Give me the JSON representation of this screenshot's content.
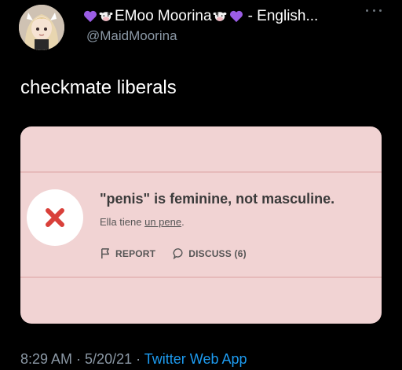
{
  "header": {
    "display_name": "EMoo Moorina",
    "name_suffix": "- English...",
    "handle": "@MaidMoorina",
    "leading_icons": [
      "purple-heart-icon",
      "cow-face-icon"
    ],
    "trailing_icons": [
      "cow-face-icon",
      "purple-heart-icon"
    ],
    "more_icon": "more-options-icon"
  },
  "tweet": {
    "text": "checkmate liberals"
  },
  "card": {
    "result_icon": "wrong-x-icon",
    "title": "\"penis\" is feminine, not masculine.",
    "sentence_before": "Ella tiene ",
    "sentence_highlight": "un pene",
    "sentence_after": ".",
    "report_label": "REPORT",
    "discuss_label": "DISCUSS (6)",
    "colors": {
      "card_bg": "#f1d3d3",
      "x_red": "#d9403a"
    }
  },
  "footer": {
    "time": "8:29 AM",
    "dot1": " · ",
    "date": "5/20/21",
    "dot2": " · ",
    "source": "Twitter Web App"
  },
  "colors": {
    "background": "#000000",
    "link": "#1d9bf0",
    "muted": "#8b98a5",
    "heart": "#9b5de5"
  }
}
